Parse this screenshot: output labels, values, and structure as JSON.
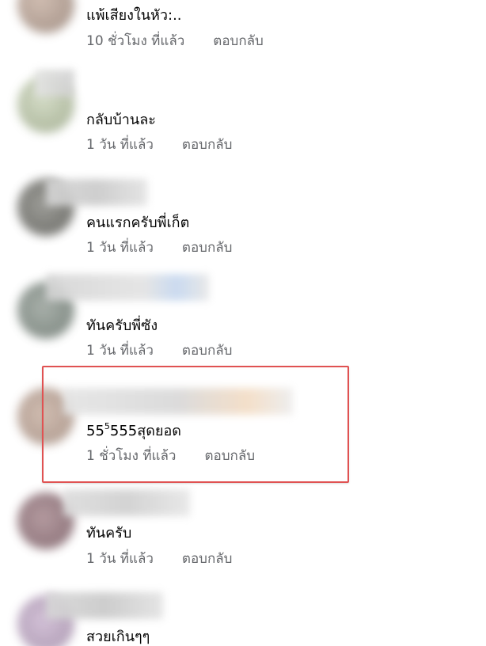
{
  "comments": [
    {
      "text": "แพ้เสียงในหัว:..",
      "time": "10 ชั่วโมง ที่แล้ว",
      "reply": "ตอบกลับ"
    },
    {
      "text": "กลับบ้านละ",
      "time": "1 วัน ที่แล้ว",
      "reply": "ตอบกลับ"
    },
    {
      "text": "คนแรกครับพี่เก็ต",
      "time": "1 วัน ที่แล้ว",
      "reply": "ตอบกลับ"
    },
    {
      "text": "ทันครับพี่ซัง",
      "time": "1 วัน ที่แล้ว",
      "reply": "ตอบกลับ"
    },
    {
      "text_main": "55",
      "text_sup": "5",
      "text_rest": "555สุดยอด",
      "time": "1 ชั่วโมง ที่แล้ว",
      "reply": "ตอบกลับ"
    },
    {
      "text": "ทันครับ",
      "time": "1 วัน ที่แล้ว",
      "reply": "ตอบกลับ"
    },
    {
      "text": "สวยเกินๆๆ"
    }
  ],
  "colors": {
    "highlight_border": "#e05252",
    "meta_text": "#65676b",
    "body_text": "#050505"
  }
}
